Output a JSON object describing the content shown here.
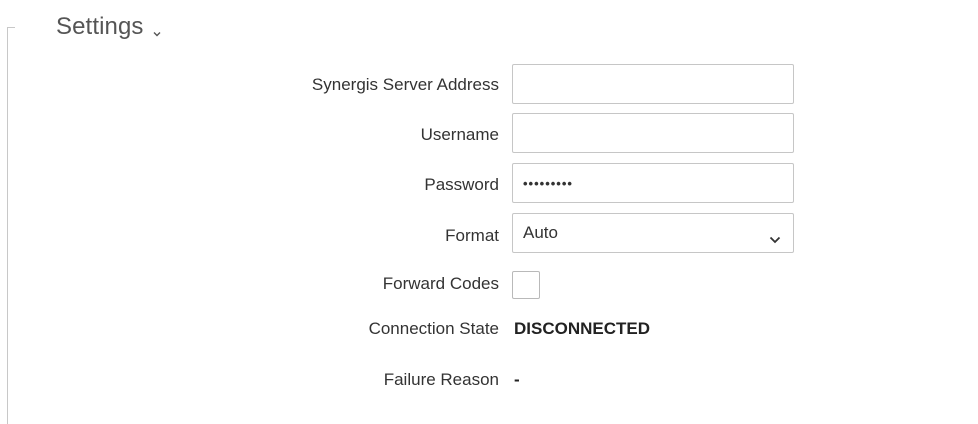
{
  "section": {
    "title": "Settings"
  },
  "icons": {
    "section_chevron": "chevron-down-icon",
    "select_chevron": "chevron-down-icon"
  },
  "form": {
    "server_address": {
      "label": "Synergis Server Address",
      "value": ""
    },
    "username": {
      "label": "Username",
      "value": ""
    },
    "password": {
      "label": "Password",
      "value": "•••••••••"
    },
    "format": {
      "label": "Format",
      "selected": "Auto"
    },
    "forward_codes": {
      "label": "Forward Codes",
      "checked": false
    },
    "connection_state": {
      "label": "Connection State",
      "value": "DISCONNECTED"
    },
    "failure_reason": {
      "label": "Failure Reason",
      "value": "-"
    }
  },
  "colors": {
    "border": "#c6c6c6",
    "text": "#333333",
    "title": "#555555"
  }
}
